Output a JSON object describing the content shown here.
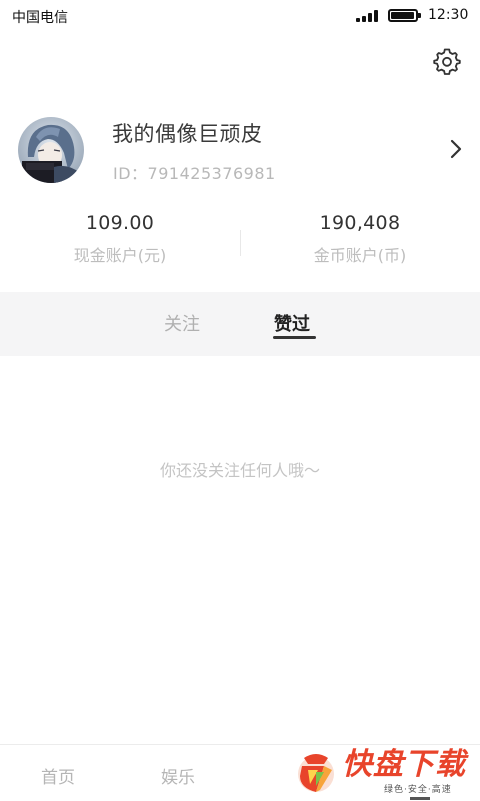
{
  "status_bar": {
    "carrier": "中国电信",
    "time": "12:30",
    "battery_level": 0.95,
    "signal_bars": 4
  },
  "header": {
    "settings_icon": "gear-icon"
  },
  "profile": {
    "nickname": "我的偶像巨顽皮",
    "user_id": "ID：791425376981",
    "chevron_icon": "chevron-right-icon"
  },
  "accounts": {
    "cash": {
      "value": "109.00",
      "label": "现金账户(元)"
    },
    "coins": {
      "value": "190,408",
      "label": "金币账户(币)"
    }
  },
  "tabs": {
    "items": [
      {
        "label": "关注",
        "active": false
      },
      {
        "label": "赞过",
        "active": true
      }
    ]
  },
  "content": {
    "empty_message": "你还没关注任何人哦～"
  },
  "bottom_nav": {
    "items": [
      {
        "label": "首页"
      },
      {
        "label": "娱乐"
      }
    ]
  },
  "watermark": {
    "title": "快盘下载",
    "subtitle": "绿色·安全·高速"
  },
  "colors": {
    "accent": "#e8442b",
    "tab_background": "#f5f5f6",
    "muted_text": "#b8b8b8"
  }
}
